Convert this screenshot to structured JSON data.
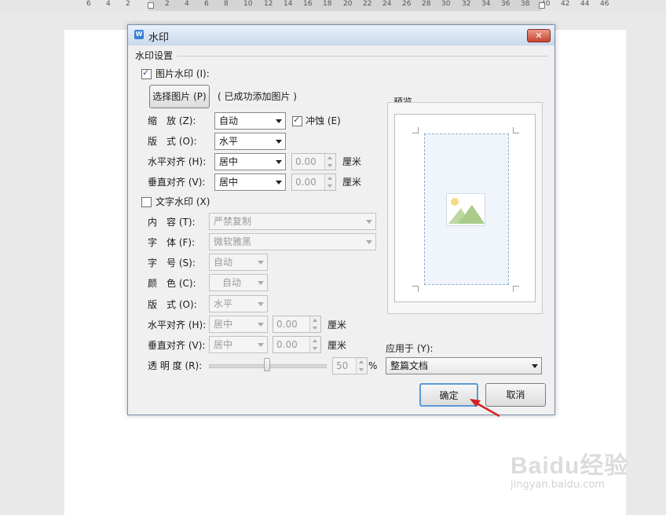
{
  "ruler": {
    "numbers": [
      "6",
      "4",
      "2",
      "2",
      "4",
      "6",
      "8",
      "10",
      "12",
      "14",
      "16",
      "18",
      "20",
      "22",
      "24",
      "26",
      "28",
      "30",
      "32",
      "34",
      "36",
      "38",
      "40",
      "42",
      "44",
      "46"
    ]
  },
  "dialog": {
    "title": "水印",
    "close_icon": "close-icon",
    "section_title": "水印设置",
    "picture": {
      "checkbox_label": "图片水印 (I):",
      "checked": true,
      "select_button": "选择图片 (P)",
      "status": "( 已成功添加图片 )",
      "scale_label": "缩　放 (Z):",
      "scale_value": "自动",
      "washout_label": "冲蚀 (E)",
      "washout_checked": true,
      "layout_label": "版　式 (O):",
      "layout_value": "水平",
      "halign_label": "水平对齐 (H):",
      "halign_value": "居中",
      "halign_num": "0.00",
      "valign_label": "垂直对齐 (V):",
      "valign_value": "居中",
      "valign_num": "0.00",
      "unit": "厘米"
    },
    "text": {
      "checkbox_label": "文字水印 (X)",
      "checked": false,
      "content_label": "内　容 (T):",
      "content_value": "严禁复制",
      "font_label": "字　体 (F):",
      "font_value": "微软雅黑",
      "size_label": "字　号 (S):",
      "size_value": "自动",
      "color_label": "颜　色 (C):",
      "color_value": "自动",
      "layout_label": "版　式 (O):",
      "layout_value": "水平",
      "halign_label": "水平对齐 (H):",
      "halign_value": "居中",
      "halign_num": "0.00",
      "valign_label": "垂直对齐 (V):",
      "valign_value": "居中",
      "valign_num": "0.00",
      "unit": "厘米",
      "transparency_label": "透 明 度 (R):",
      "transparency_value": "50",
      "transparency_unit": "%"
    },
    "preview_label": "预览",
    "apply_label": "应用于 (Y):",
    "apply_value": "整篇文档",
    "ok": "确定",
    "cancel": "取消"
  },
  "watermark": {
    "brand": "Baidu经验",
    "url": "jingyan.baidu.com"
  },
  "colors": {
    "accent": "#3a7fd5",
    "arrow": "#d42020"
  }
}
